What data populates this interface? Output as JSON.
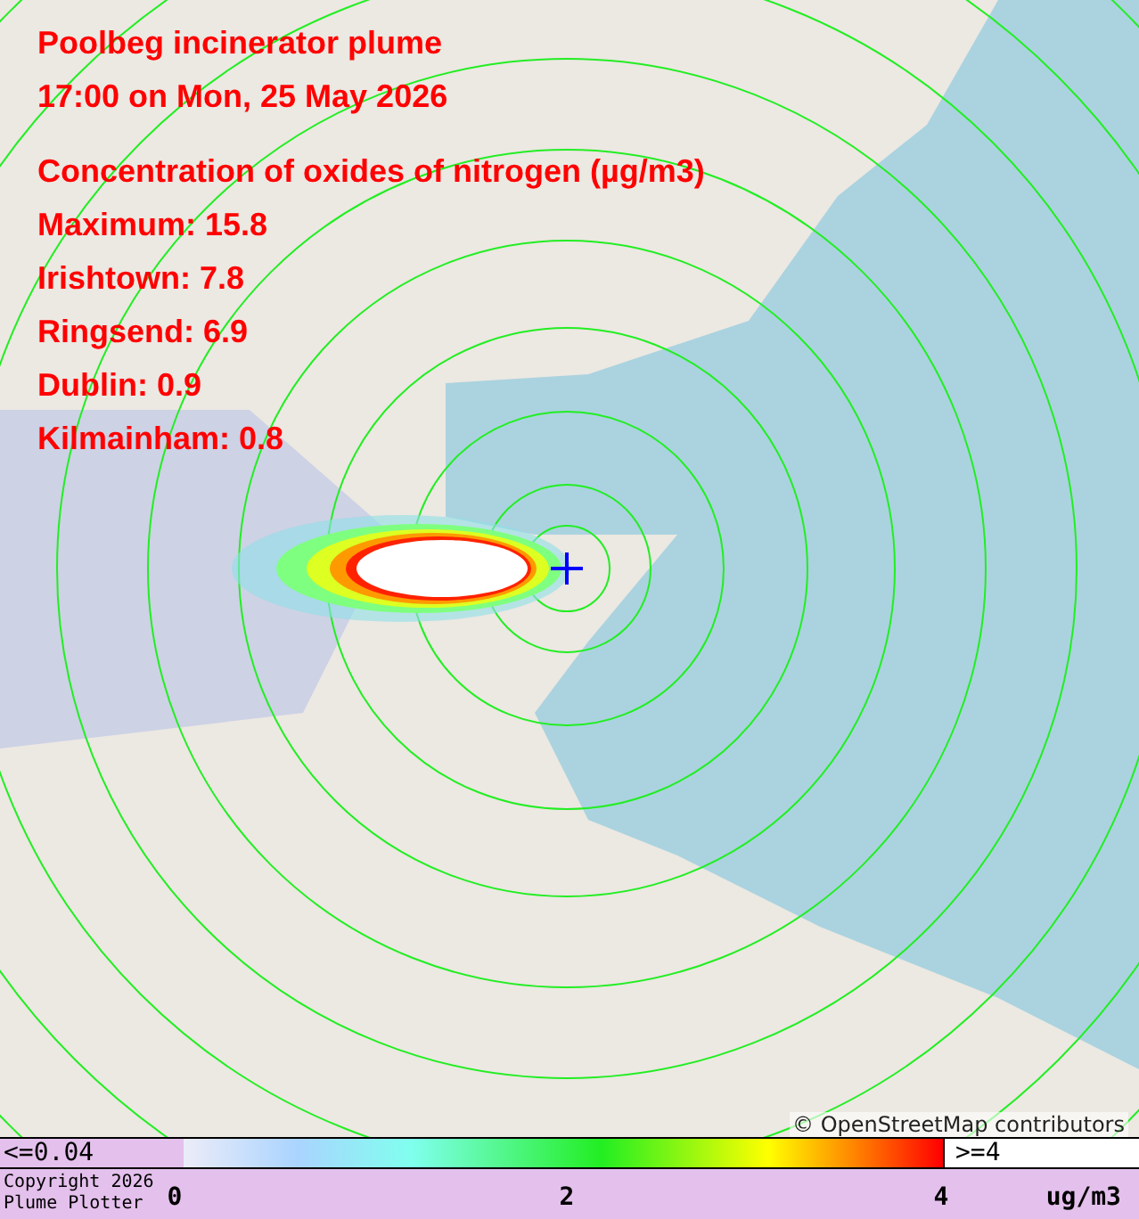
{
  "title": "Poolbeg incinerator plume",
  "time": "17:00 on Mon, 25 May 2026",
  "pollutant": "Concentration of oxides of nitrogen (µg/m3)",
  "readings": [
    "Maximum: 15.8",
    "Irishtown: 7.8",
    "Ringsend: 6.9",
    "Dublin: 0.9",
    "Kilmainham: 0.8"
  ],
  "attribution": "© OpenStreetMap contributors",
  "legend": {
    "low": "<=0.04",
    "high": ">=4",
    "ticks": [
      "0",
      "2",
      "4"
    ],
    "unit": "ug/m3",
    "copyright": [
      "Copyright 2026",
      "Plume Plotter"
    ]
  }
}
